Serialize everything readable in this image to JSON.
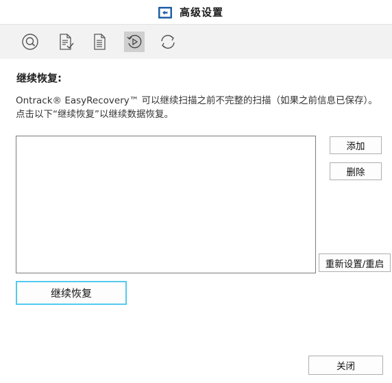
{
  "window": {
    "title": "高级设置",
    "title_icon": "back-folder-icon"
  },
  "toolbar": {
    "items": [
      {
        "icon": "scan-search-icon",
        "active": false
      },
      {
        "icon": "document-check-icon",
        "active": false
      },
      {
        "icon": "document-list-icon",
        "active": false
      },
      {
        "icon": "resume-recovery-icon",
        "active": true
      },
      {
        "icon": "refresh-icon",
        "active": false
      }
    ]
  },
  "main": {
    "heading": "继续恢复:",
    "description": "Ontrack® EasyRecovery™ 可以继续扫描之前不完整的扫描（如果之前信息已保存）。点击以下“继续恢复”以继续数据恢复。",
    "list_items": []
  },
  "buttons": {
    "add": "添加",
    "delete": "删除",
    "reset": "重新设置/重启",
    "resume": "继续恢复",
    "close": "关闭"
  },
  "colors": {
    "accent_focus": "#53c9ee",
    "toolbar_bg": "#f2f2f2",
    "title_icon_blue": "#1f5fa8"
  }
}
